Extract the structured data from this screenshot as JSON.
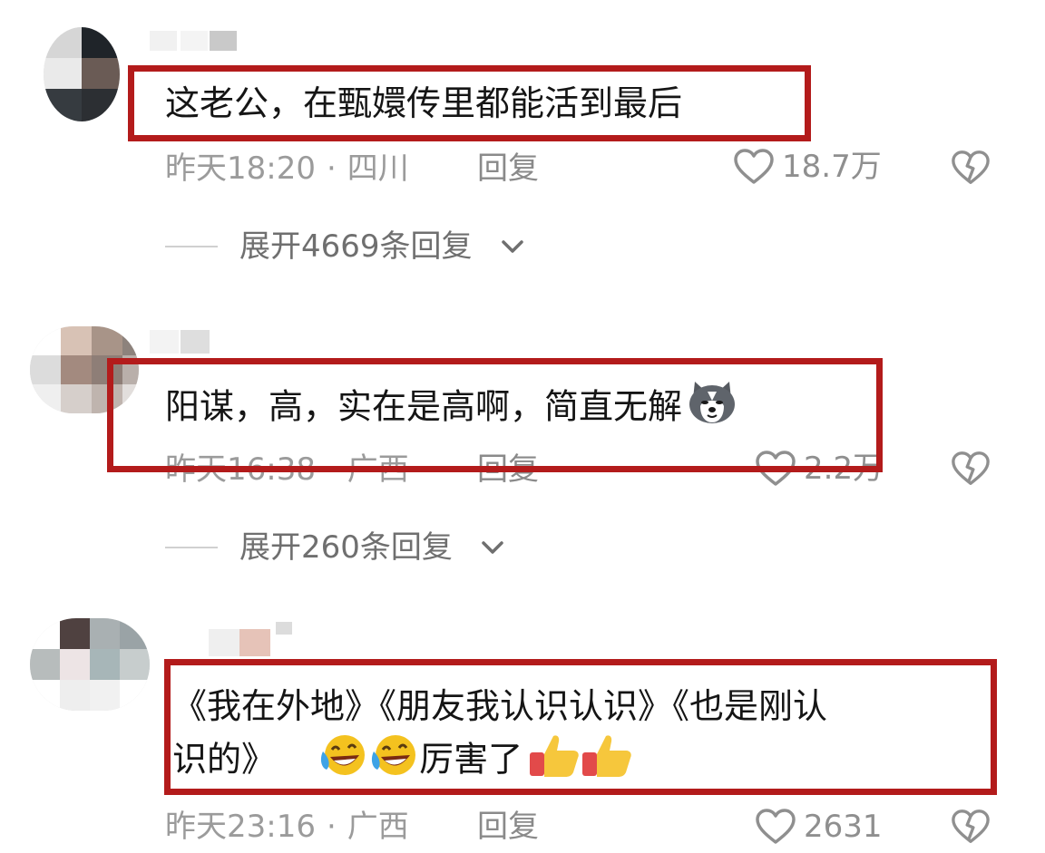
{
  "comments": [
    {
      "text": "这老公，在甄嬛传里都能活到最后",
      "time": "昨天18:20",
      "location": "四川",
      "reply_label": "回复",
      "likes": "18.7万",
      "expand_label": "展开4669条回复"
    },
    {
      "text": "阳谋，高，实在是高啊，简直无解",
      "time": "昨天16:38",
      "location": "广西",
      "reply_label": "回复",
      "likes": "2.2万",
      "expand_label": "展开260条回复"
    },
    {
      "text_line1": "《我在外地》《朋友我认识认识》《也是刚认",
      "text_line2_pre": "识的》",
      "text_line2_post": "厉害了",
      "time": "昨天23:16",
      "location": "广西",
      "reply_label": "回复",
      "likes": "2631"
    }
  ],
  "meta_separator": "·",
  "colors": {
    "highlight_border": "#b31b1b",
    "meta_text": "#9b9b9b",
    "body_text": "#151515"
  },
  "icons": {
    "like": "heart-outline-icon",
    "dislike": "broken-heart-icon",
    "expand": "chevron-down-icon",
    "dog_emoji": "husky-emoji-icon",
    "laugh_emoji": "laugh-tears-emoji-icon",
    "thumb_emoji": "thumbs-up-emoji-icon"
  }
}
